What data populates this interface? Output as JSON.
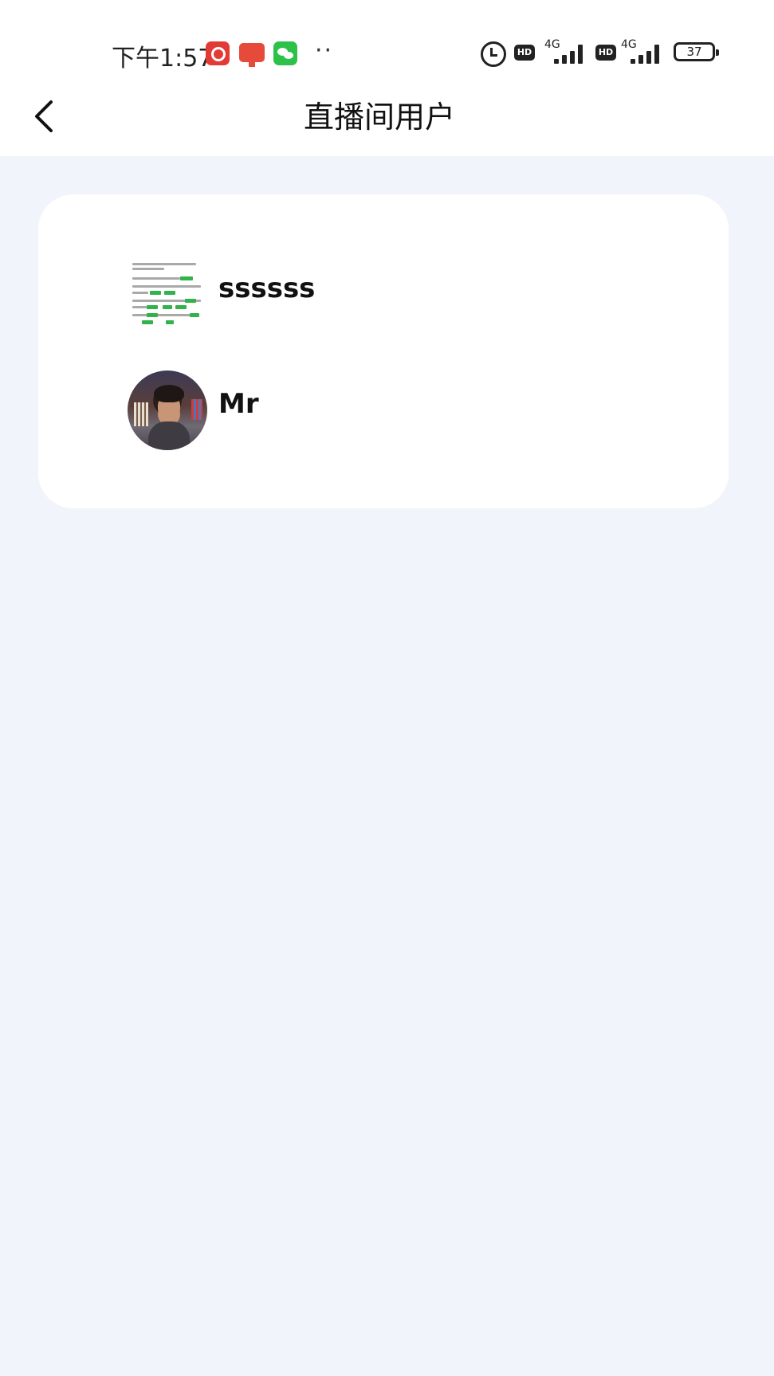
{
  "status_bar": {
    "time": "下午1:57",
    "more": "··",
    "hd_label": "HD",
    "network": "4G",
    "battery": "37"
  },
  "header": {
    "title": "直播间用户"
  },
  "users": [
    {
      "name": "ssssss"
    },
    {
      "name": "Mr"
    }
  ],
  "colors": {
    "page_background": "#f1f4fb",
    "card_background": "#ffffff",
    "text": "#111111"
  },
  "icons": {
    "back": "chevron-left-icon",
    "alarm": "alarm-icon"
  }
}
